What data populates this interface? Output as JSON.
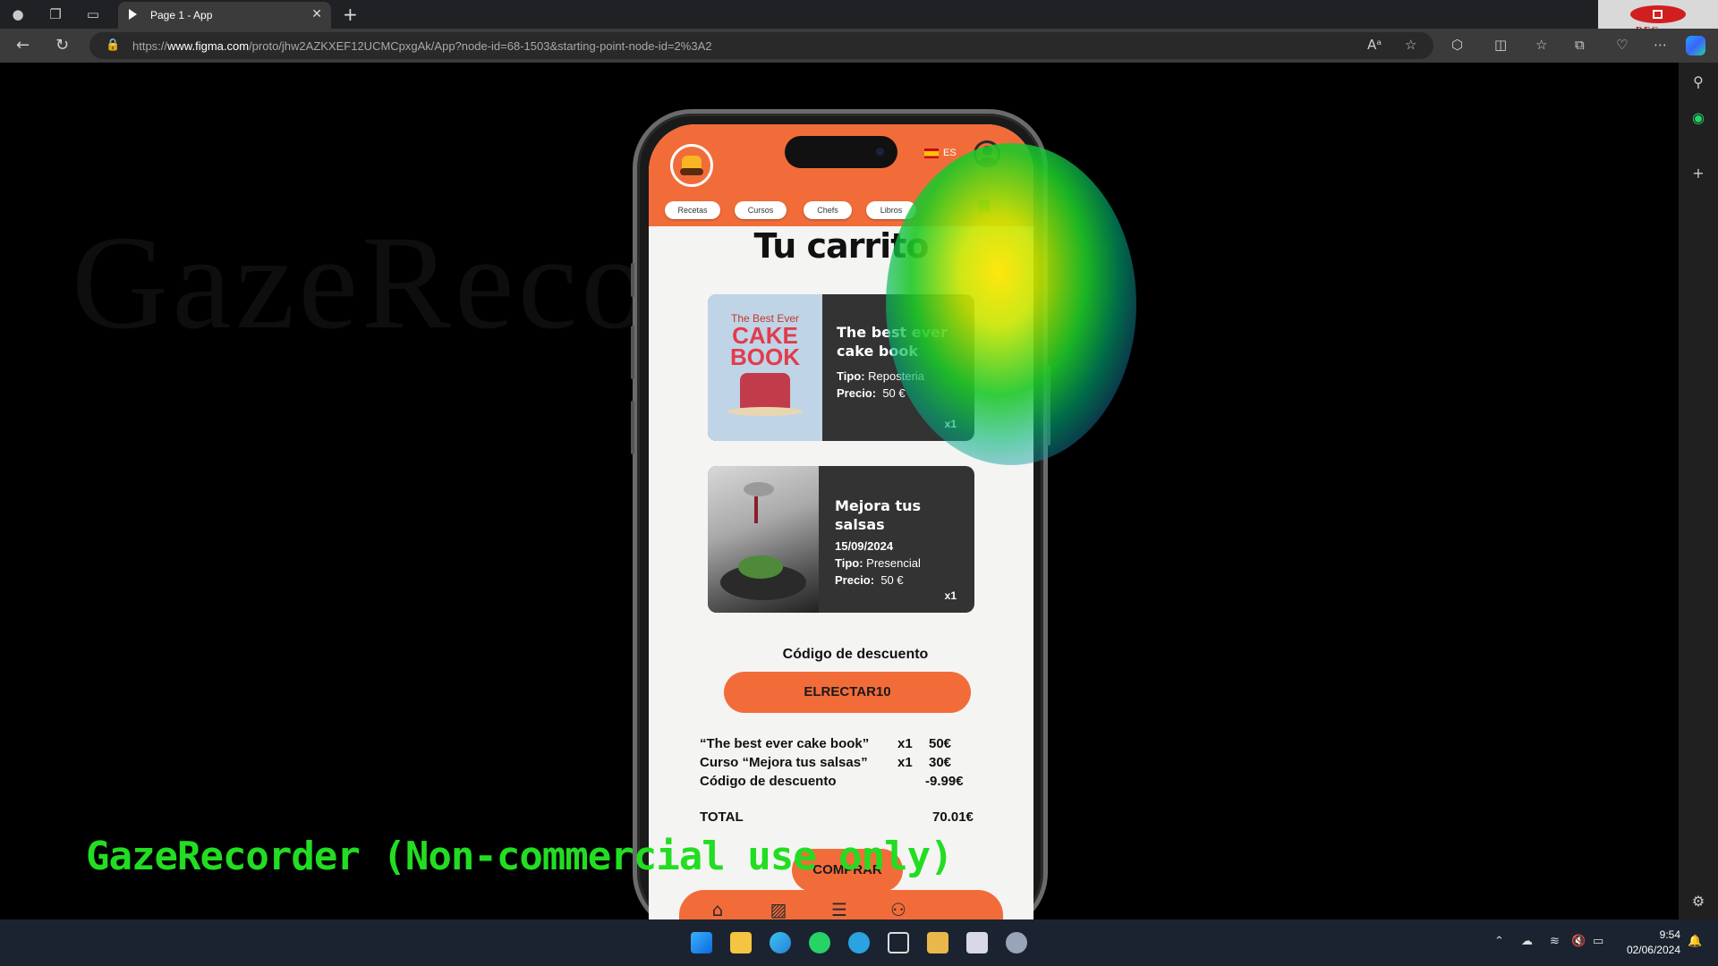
{
  "browser": {
    "tab_title": "Page 1 - App",
    "url_prefix": "https://",
    "url_domain": "www.figma.com",
    "url_rest": "/proto/jhw2AZKXEF12UCMCpxgAk/App?node-id=68-1503&starting-point-node-id=2%3A2",
    "rec_label": "REC"
  },
  "app": {
    "lang": "ES",
    "nav": [
      "Recetas",
      "Cursos",
      "Chefs",
      "Libros"
    ],
    "page_title": "Tu carrito",
    "items": [
      {
        "name": "The best ever cake book",
        "type_label": "Tipo:",
        "type": "Reposteria",
        "price_label": "Precio:",
        "price": "50 €",
        "qty": "x1",
        "cover_top": "The Best Ever",
        "cover_title": "CAKE BOOK"
      },
      {
        "name": "Mejora tus salsas",
        "date": "15/09/2024",
        "type_label": "Tipo:",
        "type": "Presencial",
        "price_label": "Precio:",
        "price": "50 €",
        "qty": "x1"
      }
    ],
    "discount_label": "Código de descuento",
    "discount_code": "ELRECTAR10",
    "summary": [
      {
        "label": "“The best ever cake book”",
        "qty": "x1",
        "value": "50€"
      },
      {
        "label": "Curso “Mejora tus salsas”",
        "qty": "x1",
        "value": "30€"
      },
      {
        "label": "Código de descuento",
        "qty": "",
        "value": "-9.99€"
      }
    ],
    "total_label": "TOTAL",
    "total_value": "70.01€",
    "buy_label": "COMPRAR"
  },
  "overlay": {
    "watermark_big": "GazeRecorder",
    "watermark_text": "GazeRecorder (Non-commercial use only)"
  },
  "taskbar": {
    "time": "9:54",
    "date": "02/06/2024"
  },
  "colors": {
    "accent": "#f26c3a",
    "card": "#333333",
    "screen_bg": "#f4f4f2"
  }
}
